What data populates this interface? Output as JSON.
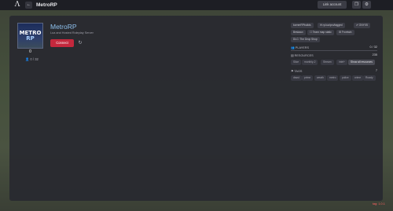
{
  "topbar": {
    "logo": "Λ",
    "back_icon": "←",
    "title": "MetroRP",
    "link_account": "Link account",
    "icon_one": "❐",
    "icon_two": "⚙"
  },
  "server": {
    "badge_line1": "METRO",
    "badge_line2": "RP",
    "count": "0",
    "players_small": "0 / 32",
    "name": "MetroRP",
    "description": "Lua and Hosted Roleplay Server",
    "connect_label": "Connect",
    "refresh_icon": "↻"
  },
  "tags_row1": [
    "kornerRPbuilds",
    "✉ rp.lua/pro/tagged",
    "✔ ONYX5"
  ],
  "tags_row2": [
    "Beskaux",
    "☐ Team map static",
    "⚙ Frontwin"
  ],
  "tags_row3": [
    "DLC: The Drop Shop"
  ],
  "players": {
    "label": "PLAYERS",
    "value": "0 / 32"
  },
  "resources": {
    "label": "RESOURCES",
    "value": "235",
    "items": [
      "Slice",
      "monthly-2",
      "Stream",
      "intel+",
      "Show all resources"
    ]
  },
  "tags_section": {
    "label": "TAGS",
    "value": "7",
    "items": [
      "dssst",
      "prime",
      "weath",
      "metro",
      "police",
      "crime",
      "Roady"
    ]
  },
  "footer_version": "tag: 1.0.1"
}
